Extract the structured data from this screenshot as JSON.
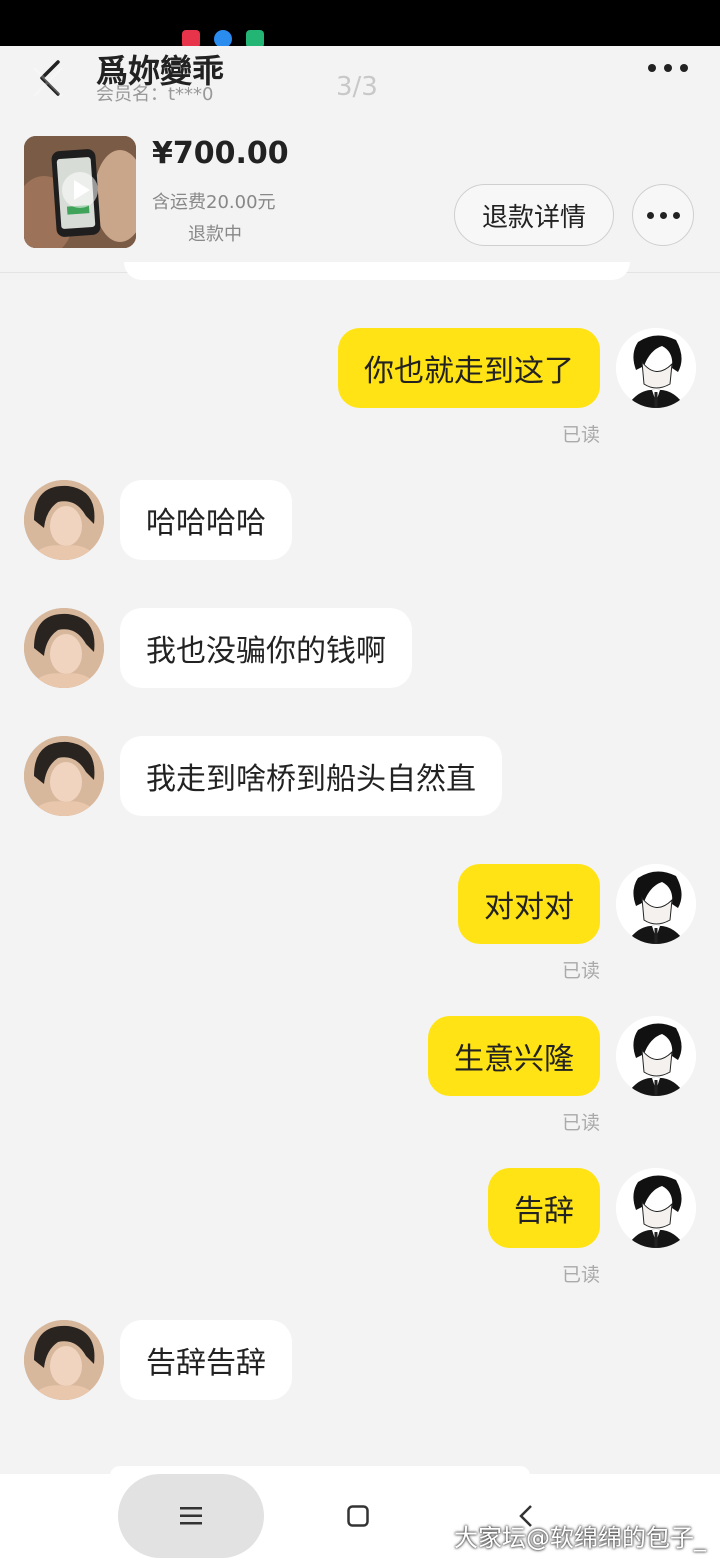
{
  "header": {
    "title": "爲妳變乖",
    "member_label": "会员名：t***0",
    "pager": "3/3"
  },
  "product": {
    "price": "¥700.00",
    "shipping": "含运费20.00元",
    "status": "退款中",
    "refund_button": "退款详情"
  },
  "messages": [
    {
      "side": "out",
      "text": "你也就走到这了",
      "read": "已读"
    },
    {
      "side": "in",
      "text": "哈哈哈哈"
    },
    {
      "side": "in",
      "text": "我也没骗你的钱啊"
    },
    {
      "side": "in",
      "text": "我走到啥桥到船头自然直"
    },
    {
      "side": "out",
      "text": "对对对",
      "read": "已读"
    },
    {
      "side": "out",
      "text": "生意兴隆",
      "read": "已读"
    },
    {
      "side": "out",
      "text": "告辞",
      "read": "已读"
    },
    {
      "side": "in",
      "text": "告辞告辞"
    }
  ],
  "watermark": "大家坛@软绵绵的包子_",
  "colors": {
    "outgoing_bubble": "#ffe314",
    "incoming_bubble": "#ffffff",
    "background": "#f3f3f3"
  }
}
